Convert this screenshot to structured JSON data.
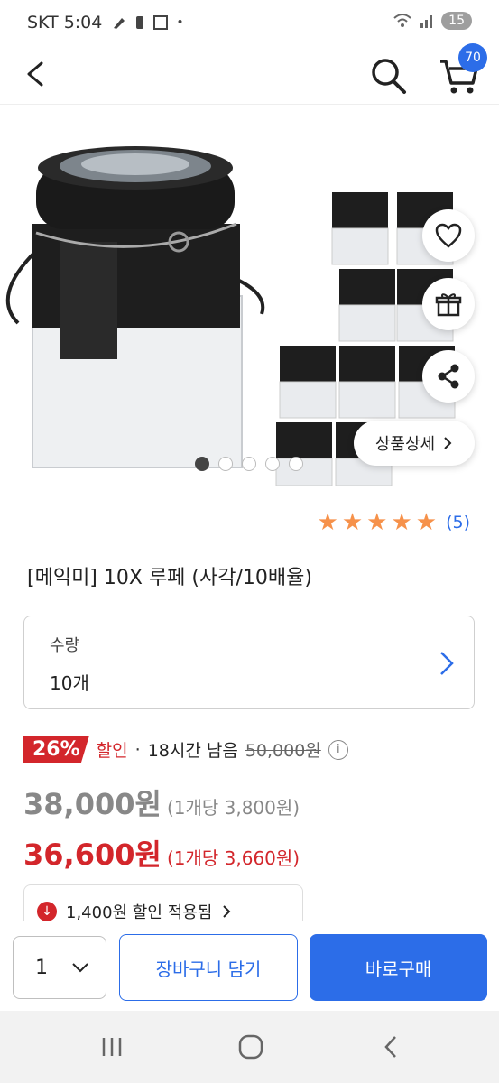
{
  "status_bar": {
    "carrier_time": "SKT 5:04",
    "battery": "15"
  },
  "header": {
    "cart_count": "70"
  },
  "gallery": {
    "detail_button_label": "상품상세",
    "dot_count": 5,
    "active_dot": 0
  },
  "rating": {
    "stars": 5,
    "review_count": "(5)"
  },
  "product": {
    "title": "[메익미] 10X 루페 (사각/10배율)"
  },
  "option": {
    "label": "수량",
    "value": "10개"
  },
  "discount": {
    "percent": "26%",
    "label": "할인",
    "separator": "·",
    "time_left": "18시간 남음",
    "original_price": "50,000원"
  },
  "prices": {
    "list_price": "38,000원",
    "list_unit": "(1개당 3,800원)",
    "sale_price": "36,600원",
    "sale_unit": "(1개당 3,660원)"
  },
  "coupon": {
    "text": "1,400원  할인 적용됨"
  },
  "bottom_bar": {
    "quantity": "1",
    "add_to_cart_label": "장바구니 담기",
    "buy_now_label": "바로구매"
  },
  "colors": {
    "accent": "#2c6de8",
    "sale": "#d3262b",
    "star": "#f6914a"
  }
}
